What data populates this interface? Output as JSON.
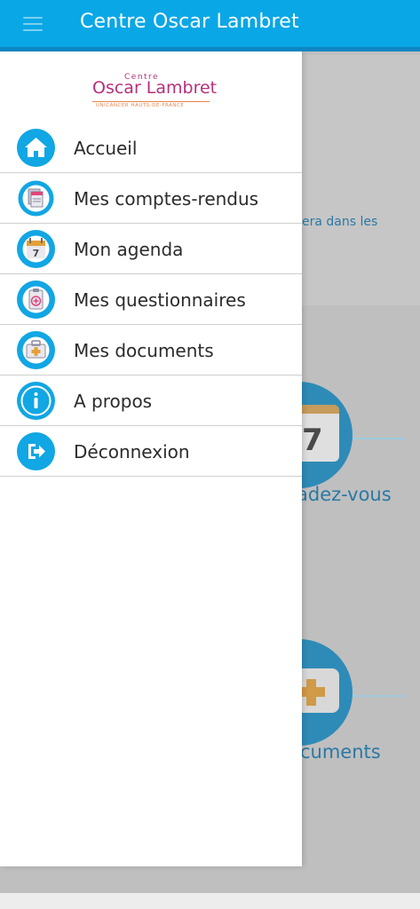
{
  "app": {
    "title": "Centre Oscar Lambret"
  },
  "logo": {
    "small": "Centre",
    "main": "Oscar Lambret",
    "sub": "UNICANCER HAUTS-DE-FRANCE"
  },
  "menu": {
    "items": [
      {
        "label": "Accueil",
        "icon": "home-icon"
      },
      {
        "label": "Mes comptes-rendus",
        "icon": "reports-icon"
      },
      {
        "label": "Mon agenda",
        "icon": "calendar-icon",
        "day": "7"
      },
      {
        "label": "Mes questionnaires",
        "icon": "questionnaire-icon"
      },
      {
        "label": "Mes documents",
        "icon": "documents-icon"
      },
      {
        "label": "A propos",
        "icon": "info-icon"
      },
      {
        "label": "Déconnexion",
        "icon": "logout-icon"
      }
    ]
  },
  "background": {
    "text_fragment": "era dans les",
    "calendar_day": "7",
    "appointments_fragment": "adez-vous",
    "documents_fragment": "cuments"
  },
  "colors": {
    "appbar": "#0aa7e6",
    "appbar_strip": "#0b86c2",
    "accent": "#11a6e4",
    "logo_brand": "#b6307a",
    "logo_secondary": "#e7844a"
  }
}
